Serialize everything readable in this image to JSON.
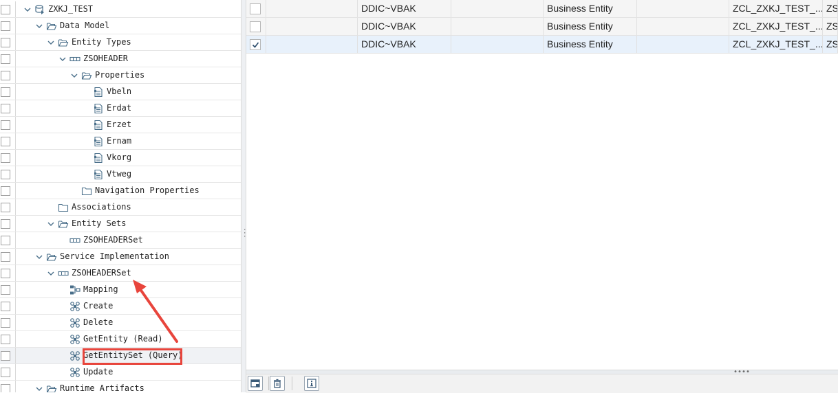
{
  "tree": {
    "rows": [
      {
        "label": "ZXKJ_TEST",
        "icon": "service-db-icon",
        "chevron": "down"
      },
      {
        "label": "Data Model",
        "icon": "folder-open-icon",
        "chevron": "down"
      },
      {
        "label": "Entity Types",
        "icon": "folder-open-icon",
        "chevron": "down"
      },
      {
        "label": "ZSOHEADER",
        "icon": "entity-icon",
        "chevron": "down"
      },
      {
        "label": "Properties",
        "icon": "folder-open-icon",
        "chevron": "down"
      },
      {
        "label": "Vbeln",
        "icon": "property-icon"
      },
      {
        "label": "Erdat",
        "icon": "property-icon"
      },
      {
        "label": "Erzet",
        "icon": "property-icon"
      },
      {
        "label": "Ernam",
        "icon": "property-icon"
      },
      {
        "label": "Vkorg",
        "icon": "property-icon"
      },
      {
        "label": "Vtweg",
        "icon": "property-icon"
      },
      {
        "label": "Navigation Properties",
        "icon": "folder-icon"
      },
      {
        "label": "Associations",
        "icon": "folder-icon"
      },
      {
        "label": "Entity Sets",
        "icon": "folder-open-icon",
        "chevron": "down"
      },
      {
        "label": "ZSOHEADERSet",
        "icon": "entity-icon"
      },
      {
        "label": "Service Implementation",
        "icon": "folder-open-icon",
        "chevron": "down"
      },
      {
        "label": "ZSOHEADERSet",
        "icon": "entity-icon",
        "chevron": "down"
      },
      {
        "label": "Mapping",
        "icon": "mapping-icon"
      },
      {
        "label": "Create",
        "icon": "operation-icon"
      },
      {
        "label": "Delete",
        "icon": "operation-icon"
      },
      {
        "label": "GetEntity (Read)",
        "icon": "operation-icon"
      },
      {
        "label": "GetEntitySet (Query)",
        "icon": "operation-icon",
        "selected": true
      },
      {
        "label": "Update",
        "icon": "operation-icon"
      },
      {
        "label": "Runtime Artifacts",
        "icon": "folder-open-icon",
        "chevron": "down"
      }
    ]
  },
  "grid": {
    "rows": [
      {
        "checked": false,
        "source": "DDIC~VBAK",
        "type": "Business Entity",
        "class": "ZCL_ZXKJ_TEST_...",
        "extra": "ZS"
      },
      {
        "checked": false,
        "source": "DDIC~VBAK",
        "type": "Business Entity",
        "class": "ZCL_ZXKJ_TEST_...",
        "extra": "ZS"
      },
      {
        "checked": true,
        "source": "DDIC~VBAK",
        "type": "Business Entity",
        "class": "ZCL_ZXKJ_TEST_...",
        "extra": "ZS"
      }
    ]
  },
  "colors": {
    "highlight": "#e8453c",
    "icon_blue": "#4a6f8a",
    "selected_row": "#e8f1fb"
  }
}
